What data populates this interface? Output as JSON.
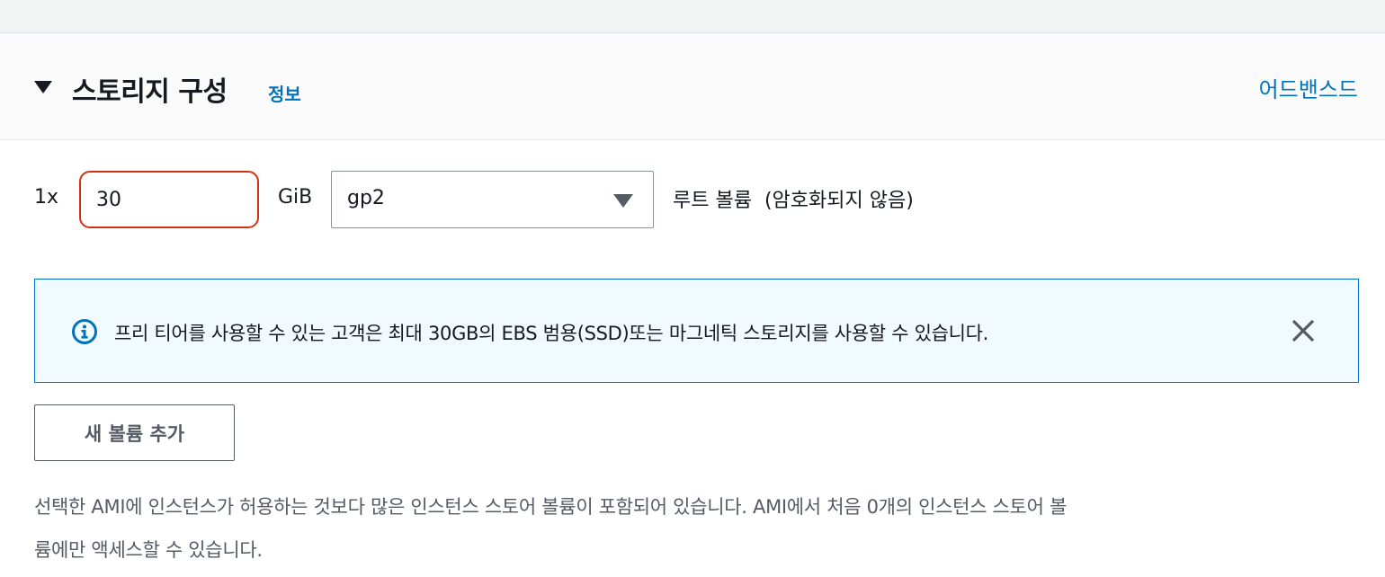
{
  "section": {
    "title": "스토리지 구성",
    "info_link": "정보",
    "advanced_link": "어드밴스드"
  },
  "volume": {
    "count_label": "1x",
    "size_value": "30",
    "unit": "GiB",
    "volume_type": "gp2",
    "root_label": "루트 볼륨  (암호화되지 않음)"
  },
  "alert": {
    "message": "프리 티어를 사용할 수 있는 고객은 최대 30GB의 EBS 범용(SSD)또는 마그네틱 스토리지를 사용할 수 있습니다.",
    "icon": "info-icon",
    "close_icon": "close-icon"
  },
  "actions": {
    "add_volume_label": "새 볼륨 추가"
  },
  "note": {
    "line1": "선택한 AMI에 인스턴스가 허용하는 것보다 많은 인스턴스 스토어 볼륨이 포함되어 있습니다. AMI에서 처음 0개의 인스턴스 스토어 볼",
    "line2": "륨에만 액세스할 수 있습니다."
  },
  "colors": {
    "link": "#0073bb",
    "error_border": "#d13212",
    "alert_border": "#0073bb",
    "alert_background": "#f1faff",
    "text": "#16191f",
    "secondary_text": "#545b64"
  }
}
